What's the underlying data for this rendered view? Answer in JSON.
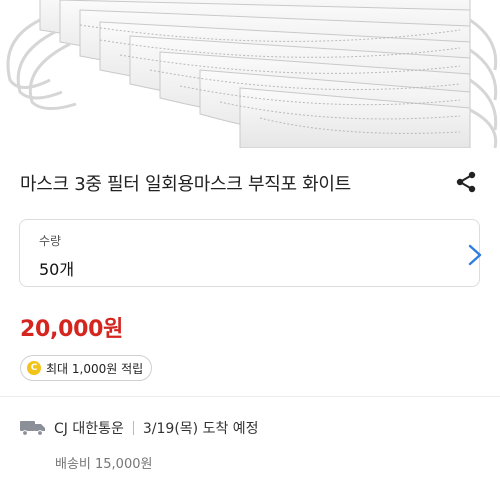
{
  "product": {
    "image_alt": "white disposable face masks",
    "title": "마스크 3중 필터 일회용마스크 부직포 화이트"
  },
  "header_actions": {
    "share_icon": "share-icon"
  },
  "quantity": {
    "label": "수량",
    "value": "50개"
  },
  "price": {
    "text": "20,000원",
    "color": "#d5251f"
  },
  "points": {
    "coin_symbol": "C",
    "text": "최대 1,000원 적립",
    "coin_color": "#f2c318"
  },
  "delivery": {
    "icon": "truck-icon",
    "carrier": "CJ 대한통운",
    "eta": "3/19(목) 도착 예정",
    "fee": "배송비 15,000원"
  },
  "colors": {
    "accent_link": "#2f7de1"
  }
}
